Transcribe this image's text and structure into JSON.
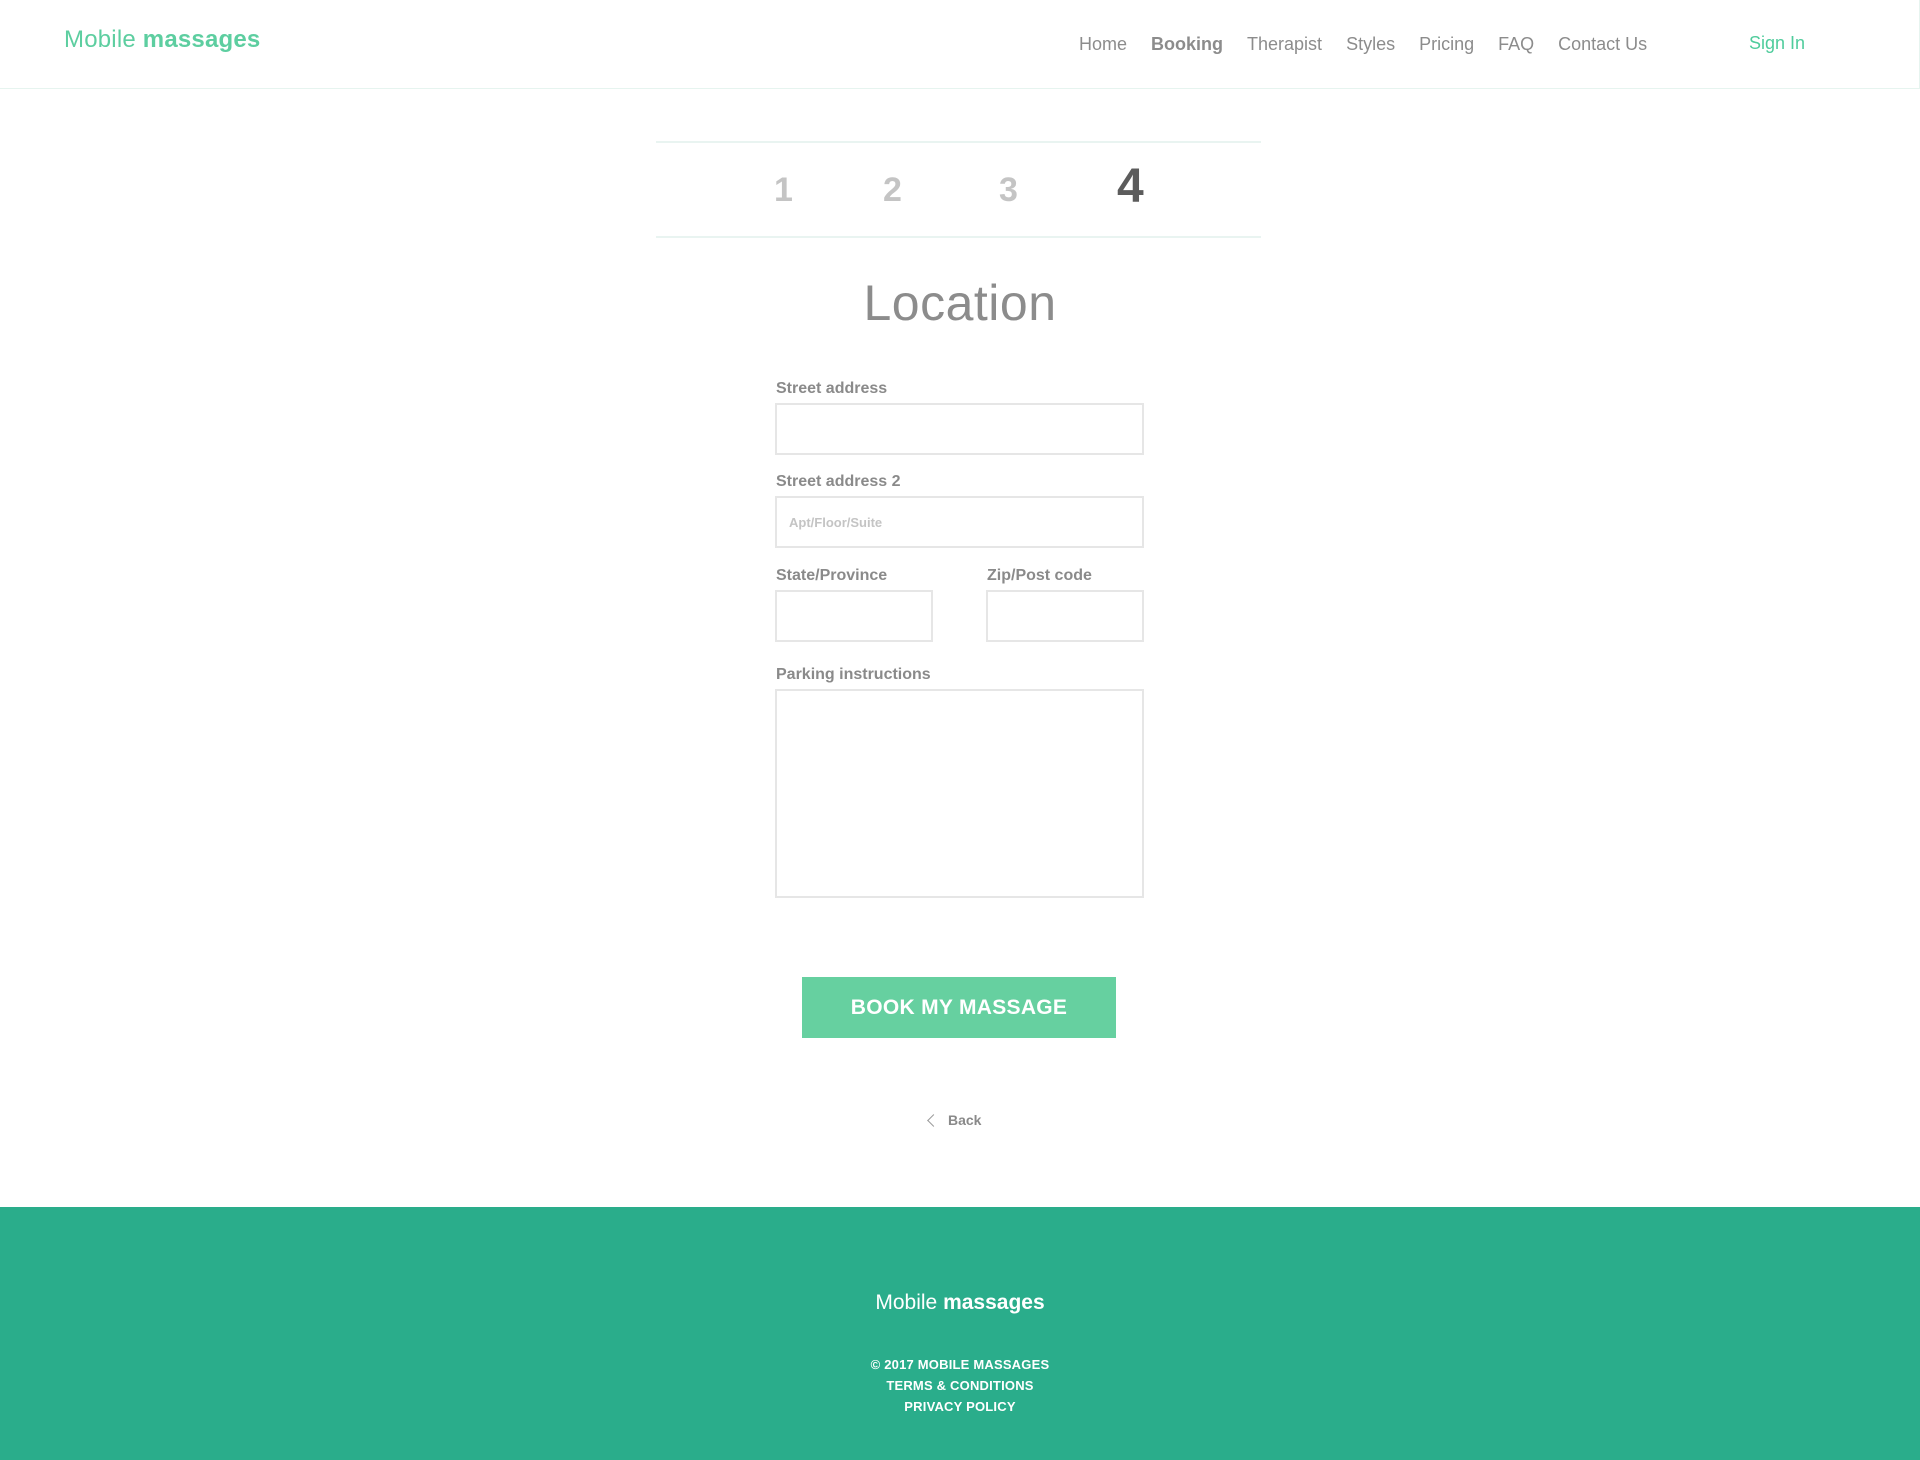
{
  "header": {
    "logo_light": "Mobile",
    "logo_bold": "massages",
    "nav": [
      "Home",
      "Booking",
      "Therapist",
      "Styles",
      "Pricing",
      "FAQ",
      "Contact Us"
    ],
    "active_nav": "Booking",
    "sign_in": "Sign In"
  },
  "steps": {
    "items": [
      "1",
      "2",
      "3",
      "4"
    ],
    "current": "4"
  },
  "form": {
    "title": "Location",
    "street_address_label": "Street address",
    "street_address_value": "",
    "street_address2_label": "Street address 2",
    "street_address2_placeholder": "Apt/Floor/Suite",
    "state_label": "State/Province",
    "zip_label": "Zip/Post code",
    "parking_label": "Parking instructions",
    "submit_label": "BOOK MY MASSAGE",
    "back_label": "Back"
  },
  "footer": {
    "logo_light": "Mobile",
    "logo_bold": "massages",
    "copyright": "© 2017 MOBILE MASSAGES",
    "terms": "TERMS & CONDITIONS",
    "privacy": "PRIVACY POLICY"
  },
  "colors": {
    "brand": "#5dcea0",
    "button": "#66d0a0",
    "footer": "#2aad8b"
  }
}
